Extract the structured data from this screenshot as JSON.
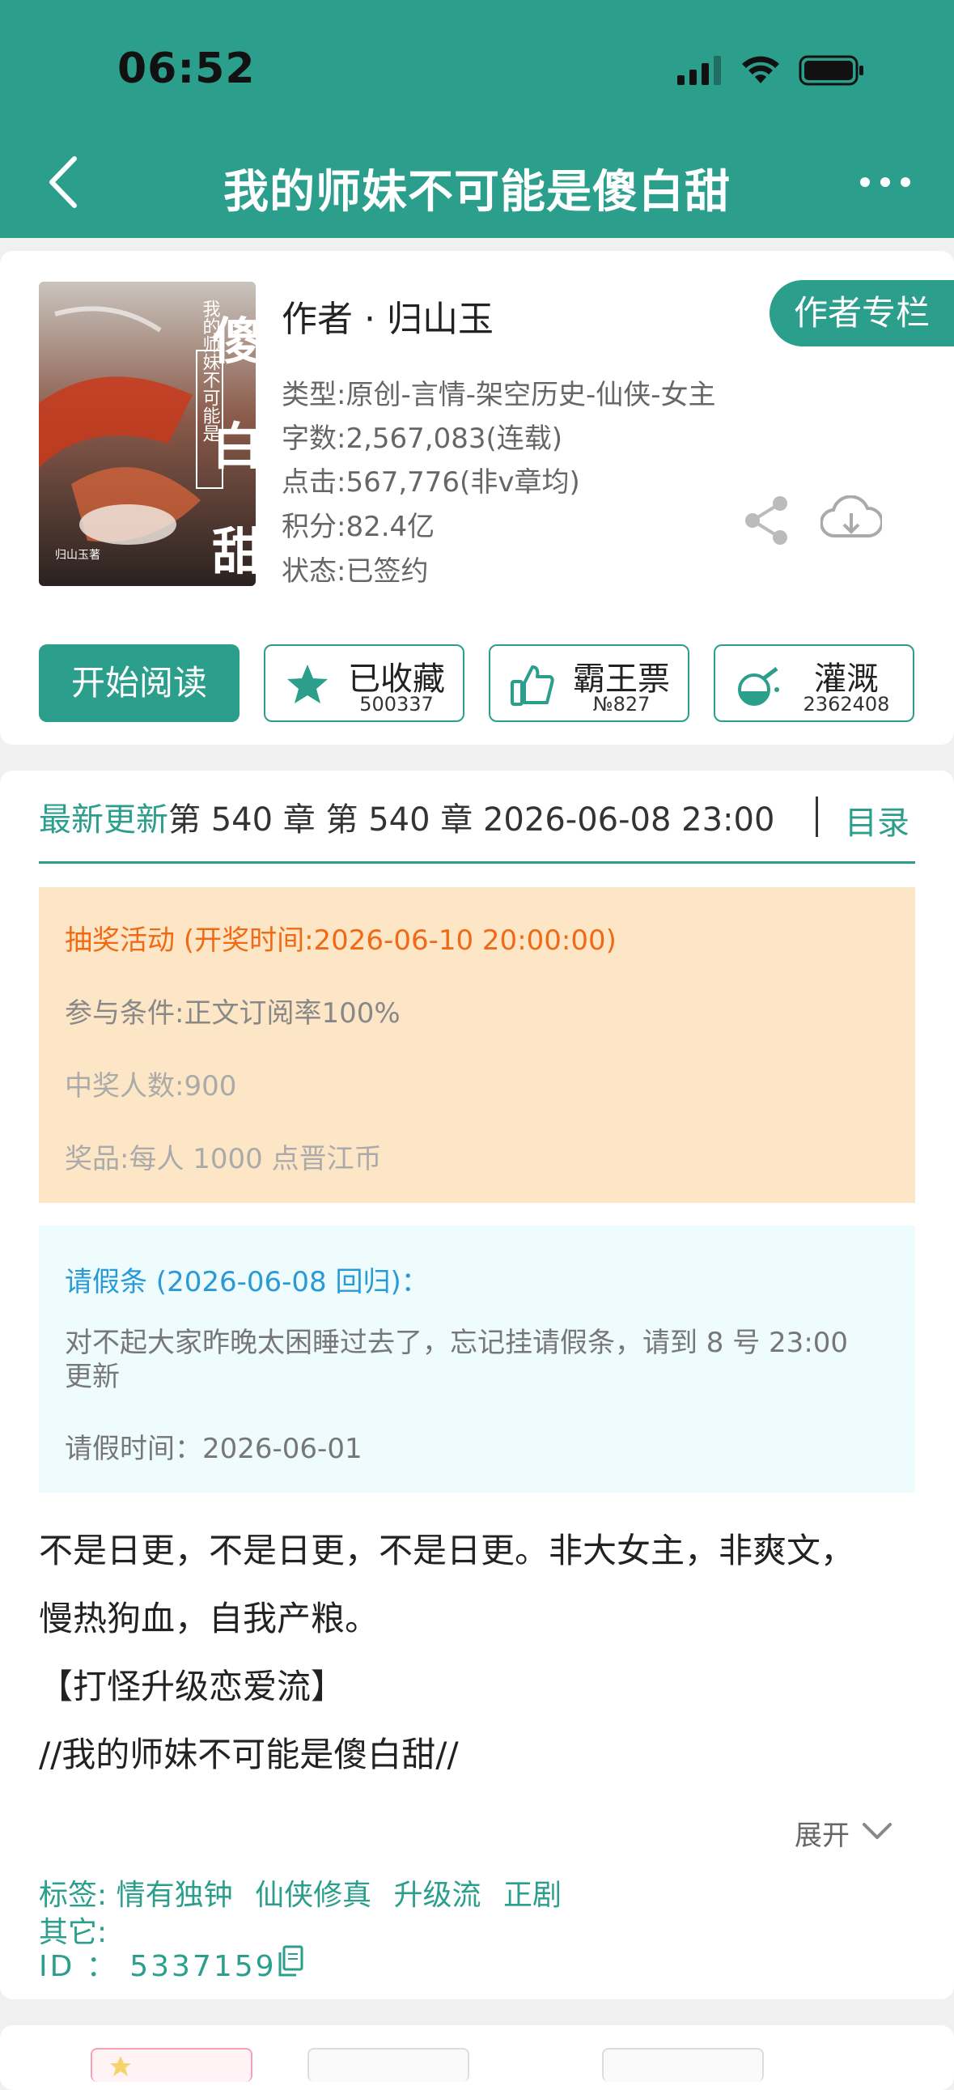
{
  "status_bar": {
    "time": "06:52"
  },
  "nav": {
    "title": "我的师妹不可能是傻白甜"
  },
  "book": {
    "cover_title_chars": "傻白甜",
    "cover_subtitle": "我的师妹不可能是",
    "author": "作者 · 归山玉",
    "author_column": "作者专栏",
    "type": "类型:原创-言情-架空历史-仙侠-女主",
    "words": "字数:2,567,083(连载)",
    "clicks": "点击:567,776(非v章均)",
    "score": "积分:82.4亿",
    "status": "状态:已签约"
  },
  "actions": {
    "start_reading": "开始阅读",
    "collect": {
      "label": "已收藏",
      "count": "500337"
    },
    "bawang": {
      "label": "霸王票",
      "count": "№827"
    },
    "irrigate": {
      "label": "灌溉",
      "count": "2362408"
    }
  },
  "update": {
    "label": "最新更新",
    "text": "第 540 章 第 540 章 2026-06-08 23:00",
    "catalog": "目录"
  },
  "lottery": {
    "title": "抽奖活动 (开奖时间:2026-06-10 20:00:00)",
    "condition": "参与条件:正文订阅率100%",
    "winners": "中奖人数:900",
    "prize": "奖品:每人 1000 点晋江币"
  },
  "leave_note": {
    "title": "请假条 (2026-06-08 回归)：",
    "text": "对不起大家昨晚太困睡过去了，忘记挂请假条，请到 8 号 23:00 更新",
    "time": "请假时间：2026-06-01"
  },
  "description": {
    "line1": "不是日更，不是日更，不是日更。非大女主，非爽文，",
    "line2": "慢热狗血，自我产粮。",
    "line3": "【打怪升级恋爱流】",
    "line4": "//我的师妹不可能是傻白甜//"
  },
  "expand": "展开",
  "tags": {
    "label": "标签:",
    "items": [
      "情有独钟",
      "仙侠修真",
      "升级流",
      "正剧"
    ]
  },
  "other_label": "其它:",
  "id_row": "ID ： 5337159",
  "colors": {
    "primary": "#2b9e8c",
    "lottery_bg": "#fde6c6",
    "leave_bg": "#eefcfe"
  }
}
